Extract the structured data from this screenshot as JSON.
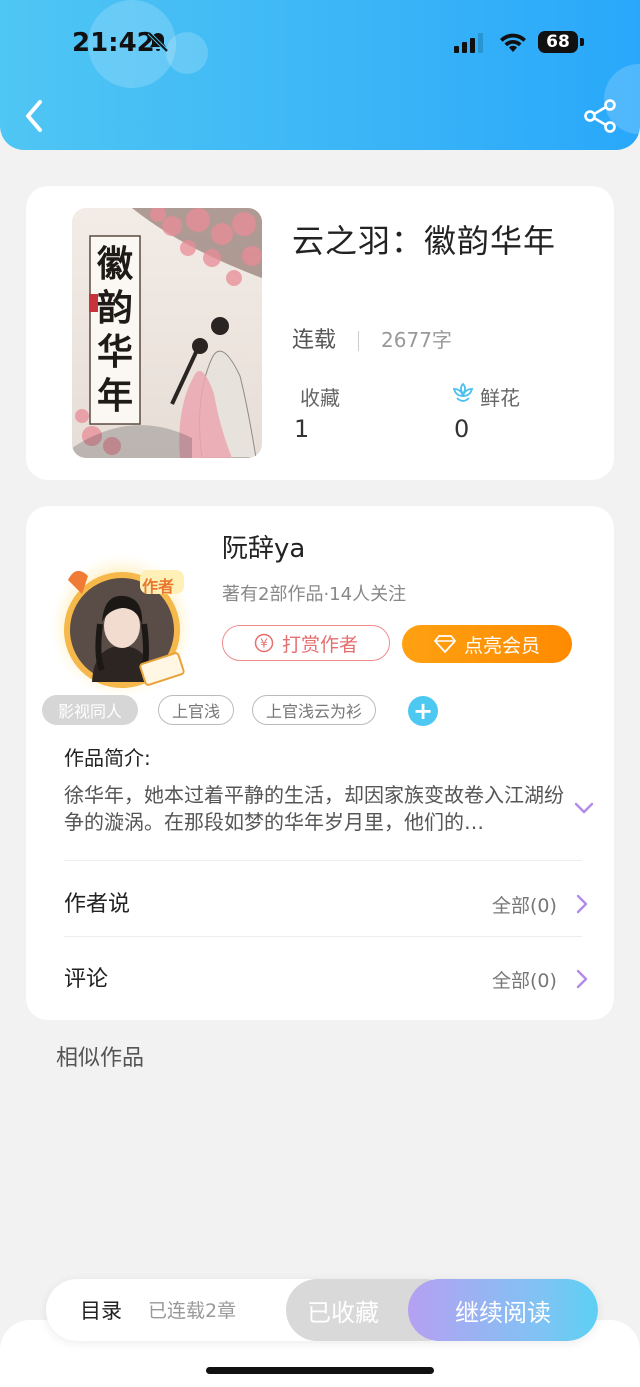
{
  "status_bar": {
    "time": "21:42",
    "battery": "68"
  },
  "book": {
    "title": "云之羽：徽韵华年",
    "cover_text": "徽韵华年",
    "status": "连载",
    "words": "2677字",
    "collect_label": "收藏",
    "collect_value": "1",
    "flower_label": "鲜花",
    "flower_value": "0"
  },
  "author": {
    "name": "阮辞ya",
    "meta": "著有2部作品·14人关注",
    "badge": "作者",
    "tip_label": "打赏作者",
    "vip_label": "点亮会员"
  },
  "tags": [
    "影视同人",
    "上官浅",
    "上官浅云为衫"
  ],
  "intro": {
    "label": "作品简介:",
    "text": "徐华年，她本过着平静的生活，却因家族变故卷入江湖纷争的漩涡。在那段如梦的华年岁月里，他们的…"
  },
  "rows": {
    "author_says_label": "作者说",
    "author_says_value": "全部(0)",
    "comments_label": "评论",
    "comments_value": "全部(0)"
  },
  "similar_label": "相似作品",
  "bottom_bar": {
    "toc_label": "目录",
    "toc_count": "已连载2章",
    "fav_label": "已收藏",
    "read_label": "继续阅读"
  },
  "colors": {
    "header": "#3ab4f7",
    "vip": "#ff9a0a",
    "tip": "#e56f6f",
    "accent_chevron": "#b38ae6"
  }
}
